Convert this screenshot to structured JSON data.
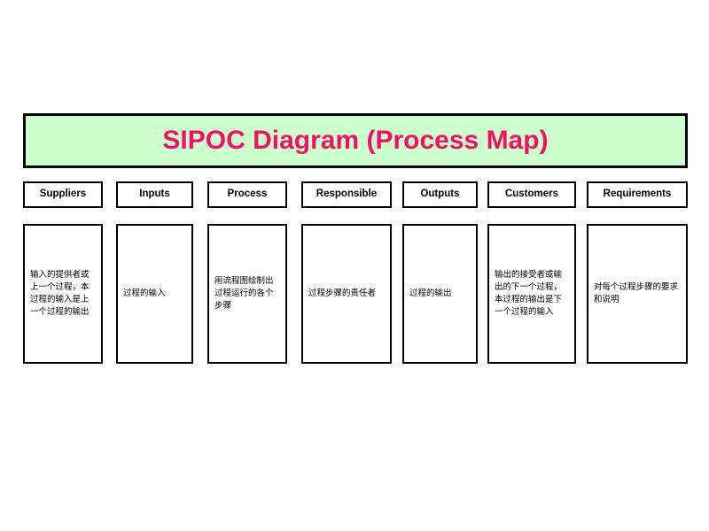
{
  "slide": {
    "title": "SIPOC Diagram (Process Map)",
    "title_background_color": "#CCFFCC",
    "title_text_color": "#EE1166",
    "border_color": "#000000",
    "page_background_color": "#FFFFFF"
  },
  "columns": [
    {
      "header": "Suppliers",
      "body": "输入的提供者或上一个过程，本过程的输入是上一个过程的输出"
    },
    {
      "header": "Inputs",
      "body": "过程的输入"
    },
    {
      "header": "Process",
      "body": "用流程图绘制出过程运行的各个步骤"
    },
    {
      "header": "Responsible",
      "body": "过程步骤的责任者"
    },
    {
      "header": "Outputs",
      "body": "过程的输出"
    },
    {
      "header": "Customers",
      "body": "输出的接受者或输出的下一个过程，本过程的输出是下一个过程的输入"
    },
    {
      "header": "Requirements",
      "body": "对每个过程步骤的要求和说明"
    }
  ]
}
